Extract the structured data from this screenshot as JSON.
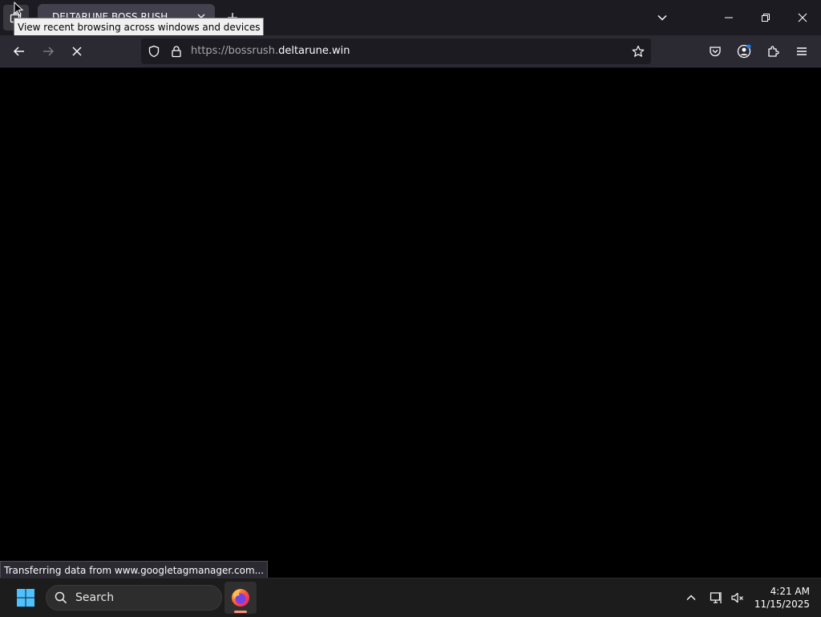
{
  "browser": {
    "tab": {
      "title": "DELTARUNE BOSS RUSH"
    },
    "tooltip": "View recent browsing across windows and devices",
    "url": {
      "scheme_host_prefix": "https://bossrush.",
      "domain": "deltarune.win"
    },
    "status": "Transferring data from www.googletagmanager.com..."
  },
  "taskbar": {
    "search_placeholder": "Search",
    "clock": {
      "time": "4:21 AM",
      "date": "11/15/2025"
    }
  },
  "colors": {
    "tabbar_bg": "#1c1b22",
    "navbar_bg": "#2b2a33",
    "urlbar_bg": "#1c1b22",
    "page_bg": "#000000",
    "taskbar_bg": "#1c1c1c",
    "accent_blue": "#0a84ff"
  }
}
